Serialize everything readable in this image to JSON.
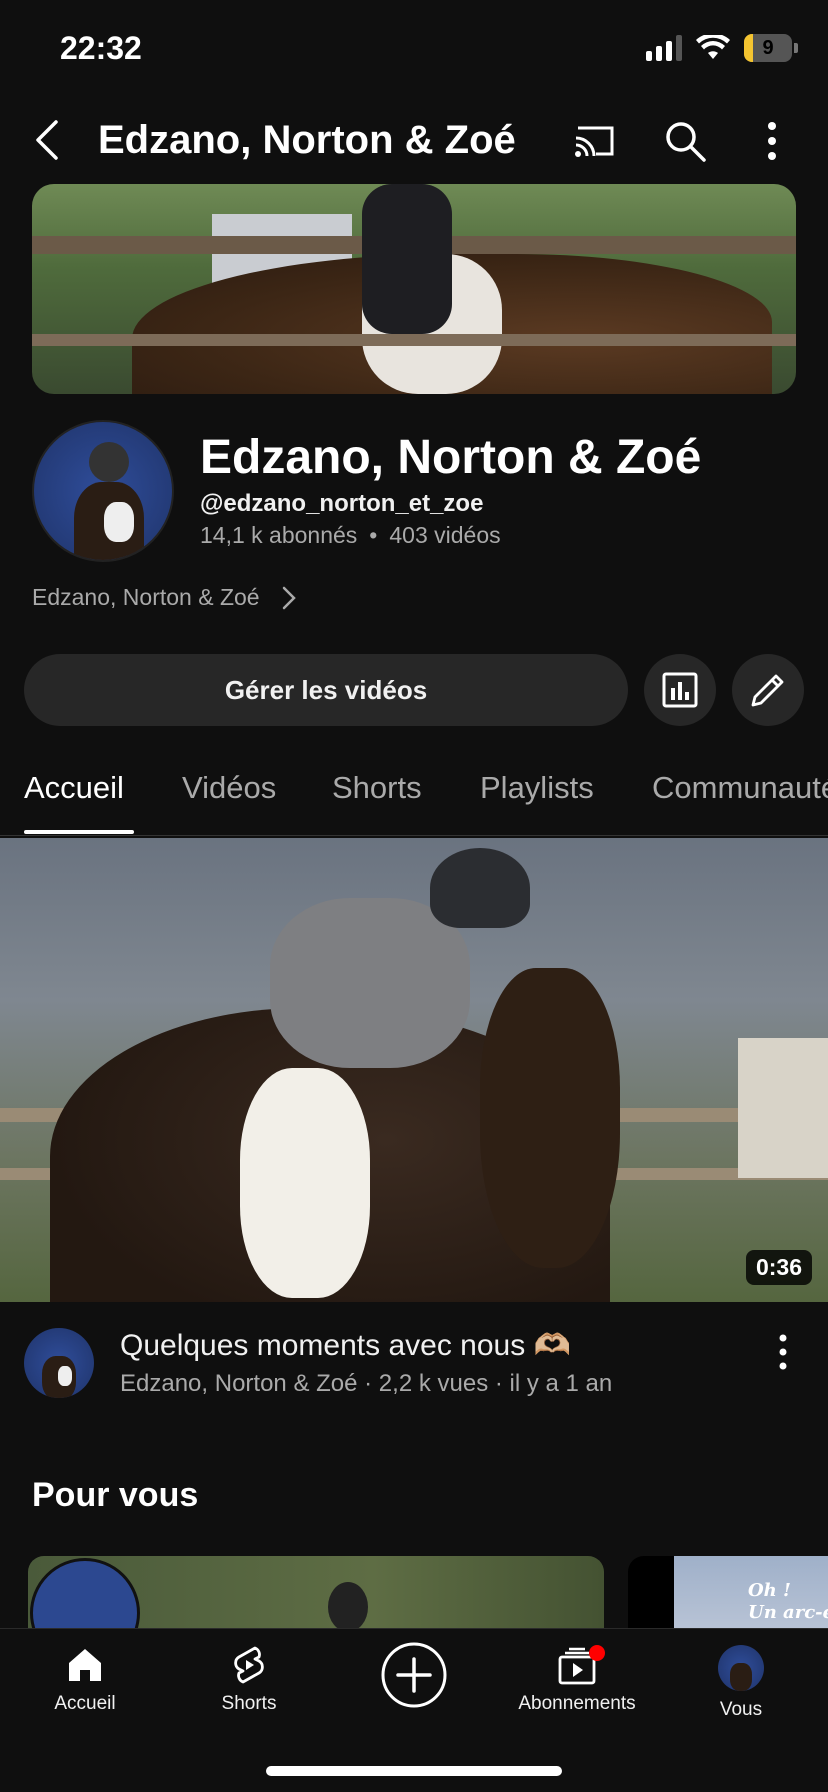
{
  "status_bar": {
    "time": "22:32",
    "battery": "9",
    "battery_level_percent": 9
  },
  "topbar": {
    "title": "Edzano, Norton & Zoé",
    "icons": [
      "back-icon",
      "cast-icon",
      "search-icon",
      "more-vert-icon"
    ]
  },
  "channel": {
    "name": "Edzano, Norton & Zoé",
    "handle": "@edzano_norton_et_zoe",
    "subscribers": "14,1 k abonnés",
    "separator": "•",
    "videos": "403 vidéos",
    "link_text": "Edzano, Norton & Zoé"
  },
  "actions": {
    "manage_label": "Gérer les vidéos",
    "icons": [
      "analytics-icon",
      "edit-icon"
    ]
  },
  "tabs": [
    {
      "label": "Accueil",
      "active": true
    },
    {
      "label": "Vidéos",
      "active": false
    },
    {
      "label": "Shorts",
      "active": false
    },
    {
      "label": "Playlists",
      "active": false
    },
    {
      "label": "Communauté",
      "active": false
    }
  ],
  "featured_video": {
    "duration": "0:36",
    "title": "Quelques moments avec nous 🫶🏼",
    "meta": "Edzano, Norton & Zoé · 2,2 k vues · il y a 1 an"
  },
  "for_you": {
    "title": "Pour vous",
    "card2_text_line1": "Oh ! ",
    "card2_text_line2": "Un arc-en-ciel"
  },
  "bottom_nav": [
    {
      "label": "Accueil",
      "icon": "home-icon",
      "active": true
    },
    {
      "label": "Shorts",
      "icon": "shorts-icon",
      "active": false
    },
    {
      "label": "",
      "icon": "add-icon",
      "active": false
    },
    {
      "label": "Abonnements",
      "icon": "subscriptions-icon",
      "active": false,
      "badge": true
    },
    {
      "label": "Vous",
      "icon": "avatar",
      "active": false
    }
  ],
  "colors": {
    "background": "#0f0f0f",
    "surface": "#272727",
    "text_primary": "#f1f1f1",
    "text_secondary": "#aaaaaa",
    "badge_red": "#ff0000",
    "battery_yellow": "#f4c430"
  }
}
